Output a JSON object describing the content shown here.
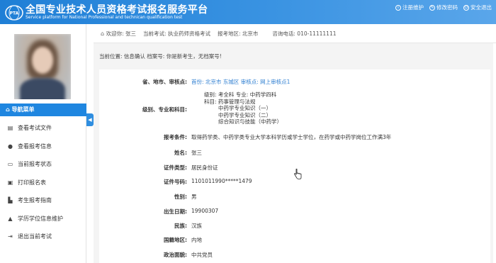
{
  "header": {
    "title_cn": "全国专业技术人员资格考试报名服务平台",
    "title_en": "Service platform for National Professional and technican qualification test",
    "links": [
      {
        "label": "注册维护",
        "icon": "info-icon"
      },
      {
        "label": "修改密码",
        "icon": "edit-icon"
      },
      {
        "label": "安全退出",
        "icon": "power-icon"
      }
    ]
  },
  "infobar": {
    "welcome": "欢迎你: 张三",
    "exam": "当前考试: 执业药师资格考试",
    "region": "报考地区: 北京市",
    "phone": "咨询电话: 010-11111111"
  },
  "sidebar": {
    "menu_title": "导航菜单",
    "items": [
      {
        "label": "查看考试文件",
        "icon": "file-icon"
      },
      {
        "label": "查看报考信息",
        "icon": "info-icon"
      },
      {
        "label": "当前报考状态",
        "icon": "monitor-icon"
      },
      {
        "label": "打印报名表",
        "icon": "print-icon"
      },
      {
        "label": "考生报考指南",
        "icon": "book-icon"
      },
      {
        "label": "学历学位信息维护",
        "icon": "graduation-icon"
      },
      {
        "label": "退出当前考试",
        "icon": "logout-icon"
      }
    ]
  },
  "breadcrumb": "当前位置: 信息确认  档案号: 你是新考生，无档案号!",
  "form": {
    "region_label": "省、地市、审核点:",
    "region_prefix": "首份:",
    "region_city": "北京市",
    "region_district": "东城区",
    "region_audit_prefix": "审核点:",
    "region_audit": "网上审核点1",
    "level_label": "级别、专业和科目:",
    "level_line": "级别: 考全科   专业: 中药学四科",
    "subjects_prefix": "科目:",
    "subjects": [
      "药事管理与法规",
      "中药学专业知识（一）",
      "中药学专业知识（二）",
      "综合知识与技能（中药学）"
    ],
    "condition_label": "报考条件:",
    "condition": "取得药学类、中药学类专业大学本科学历或学士学位，在药学或中药学岗位工作满3年",
    "name_label": "姓名:",
    "name": "张三",
    "idtype_label": "证件类型:",
    "idtype": "居民身份证",
    "idnum_label": "证件号码:",
    "idnum": "1101011990*****1479",
    "gender_label": "性别:",
    "gender": "男",
    "birth_label": "出生日期:",
    "birth": "19900307",
    "ethnic_label": "民族:",
    "ethnic": "汉族",
    "nation_label": "国籍地区:",
    "nation": "内地",
    "political_label": "政治面貌:",
    "political": "中共党员"
  },
  "colors": {
    "header": "#2a88dc",
    "menu_active": "#1f86e0",
    "link": "#2f7fd1"
  }
}
